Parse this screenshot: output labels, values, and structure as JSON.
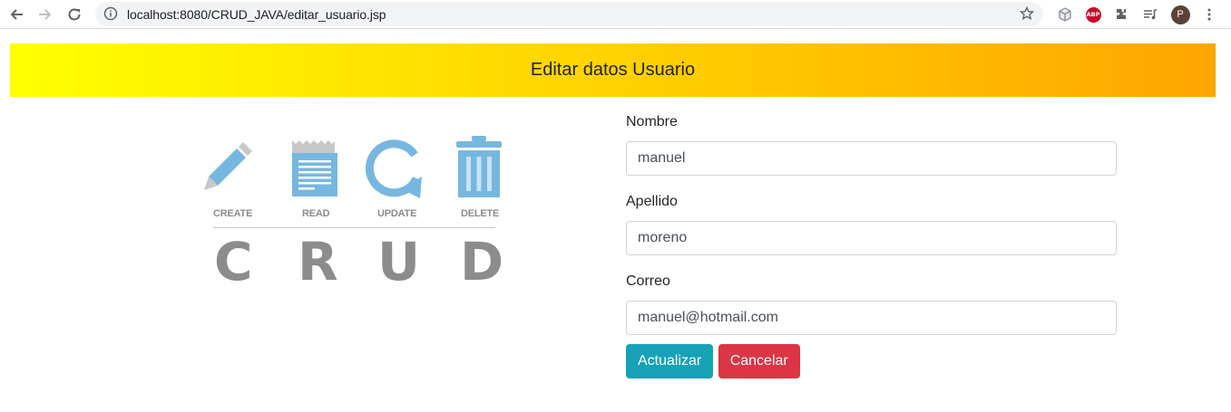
{
  "browser": {
    "url": "localhost:8080/CRUD_JAVA/editar_usuario.jsp",
    "avatar_initial": "P",
    "abp_label": "ABP"
  },
  "header": {
    "title": "Editar datos Usuario"
  },
  "crud_image": {
    "labels": [
      "CREATE",
      "READ",
      "UPDATE",
      "DELETE"
    ],
    "letters": [
      "C",
      "R",
      "U",
      "D"
    ],
    "icon_color": "#76b7e0",
    "text_color": "#8c8c8c"
  },
  "form": {
    "nombre_label": "Nombre",
    "nombre_value": "manuel",
    "apellido_label": "Apellido",
    "apellido_value": "moreno",
    "correo_label": "Correo",
    "correo_value": "manuel@hotmail.com",
    "update_button": "Actualizar",
    "cancel_button": "Cancelar"
  },
  "colors": {
    "gradient_start": "#ffff00",
    "gradient_end": "#ffa500",
    "info": "#17a2b8",
    "danger": "#dc3545"
  }
}
